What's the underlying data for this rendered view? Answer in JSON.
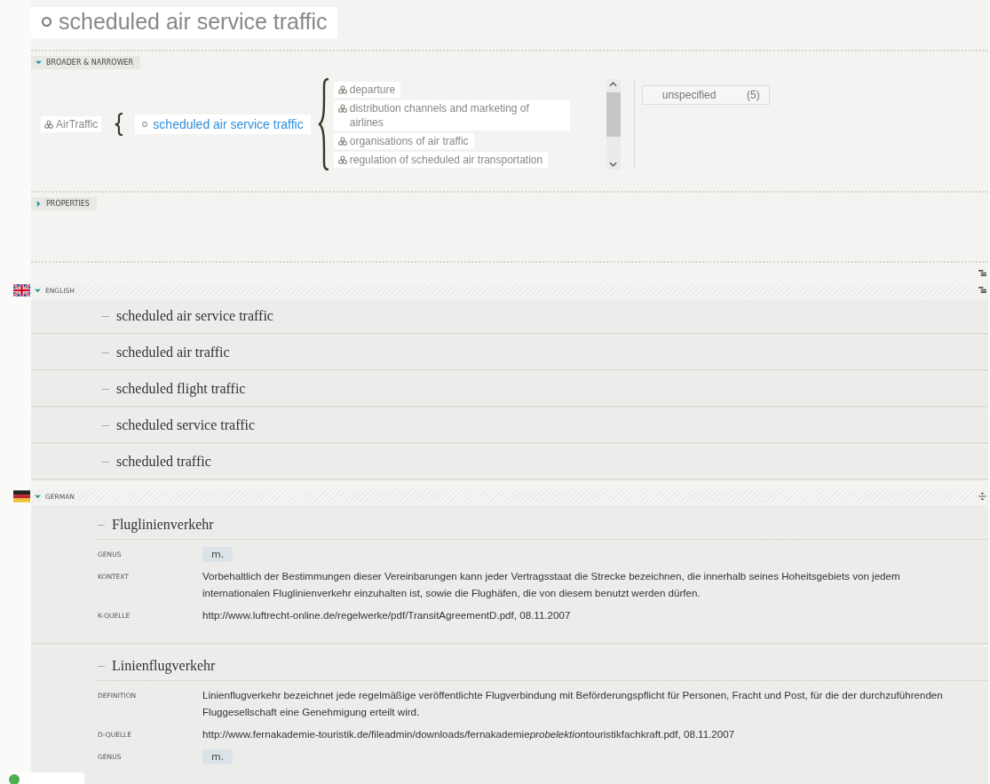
{
  "title": "scheduled air service traffic",
  "broader_narrower": {
    "label": "BROADER & NARROWER",
    "expanded": true,
    "broader": [
      {
        "label": "AirTraffic"
      }
    ],
    "current": "scheduled air service traffic",
    "narrower": [
      {
        "label": "departure"
      },
      {
        "label": "distribution channels and marketing of airlines"
      },
      {
        "label": "organisations of air traffic"
      },
      {
        "label": "regulation of scheduled air transportation"
      }
    ],
    "facet": {
      "label": "unspecified",
      "count": "(5)"
    }
  },
  "properties": {
    "label": "PROPERTIES",
    "expanded": false
  },
  "languages": [
    {
      "kind": "gb",
      "label": "ENGLISH",
      "expanded": true,
      "terms": [
        {
          "term": "scheduled air service traffic"
        },
        {
          "term": "scheduled air traffic"
        },
        {
          "term": "scheduled flight traffic"
        },
        {
          "term": "scheduled service traffic"
        },
        {
          "term": "scheduled traffic"
        }
      ]
    },
    {
      "kind": "de",
      "label": "GERMAN",
      "expanded": true,
      "terms": [
        {
          "term": "Fluglinienverkehr",
          "properties": [
            {
              "label": "GENUS",
              "value": "m.",
              "kind": "tag"
            },
            {
              "label": "KONTEXT",
              "value": "Vorbehaltlich der Bestimmungen dieser Vereinbarungen kann jeder Vertragsstaat die Strecke bezeichnen, die innerhalb seines Hoheitsgebiets von jedem internationalen Fluglinienverkehr einzuhalten ist, sowie die Flughäfen, die von diesem benutzt werden dürfen.",
              "kind": "text"
            },
            {
              "label": "K-QUELLE",
              "value": "http://www.luftrecht-online.de/regelwerke/pdf/TransitAgreementD.pdf, 08.11.2007",
              "kind": "text"
            }
          ]
        },
        {
          "term": "Linienflugverkehr",
          "properties": [
            {
              "label": "DEFINITION",
              "value": "Linienflugverkehr bezeichnet jede regelmäßige veröffentlichte Flugverbindung mit Beförderungspflicht für Personen, Fracht und Post, für die der durchzuführenden Fluggesellschaft eine Genehmigung erteilt wird.",
              "kind": "text"
            },
            {
              "label": "D-QUELLE",
              "kind": "parts",
              "parts": [
                {
                  "text": "http://www.fernakademie-touristik.de/fileadmin/downloads/fernakademie",
                  "italic": false
                },
                {
                  "text": "probelektion",
                  "italic": true
                },
                {
                  "text": "touristikfachkraft.pdf, 08.11.2007",
                  "italic": false
                }
              ]
            },
            {
              "label": "GENUS",
              "value": "m.",
              "kind": "tag"
            }
          ]
        }
      ]
    }
  ]
}
